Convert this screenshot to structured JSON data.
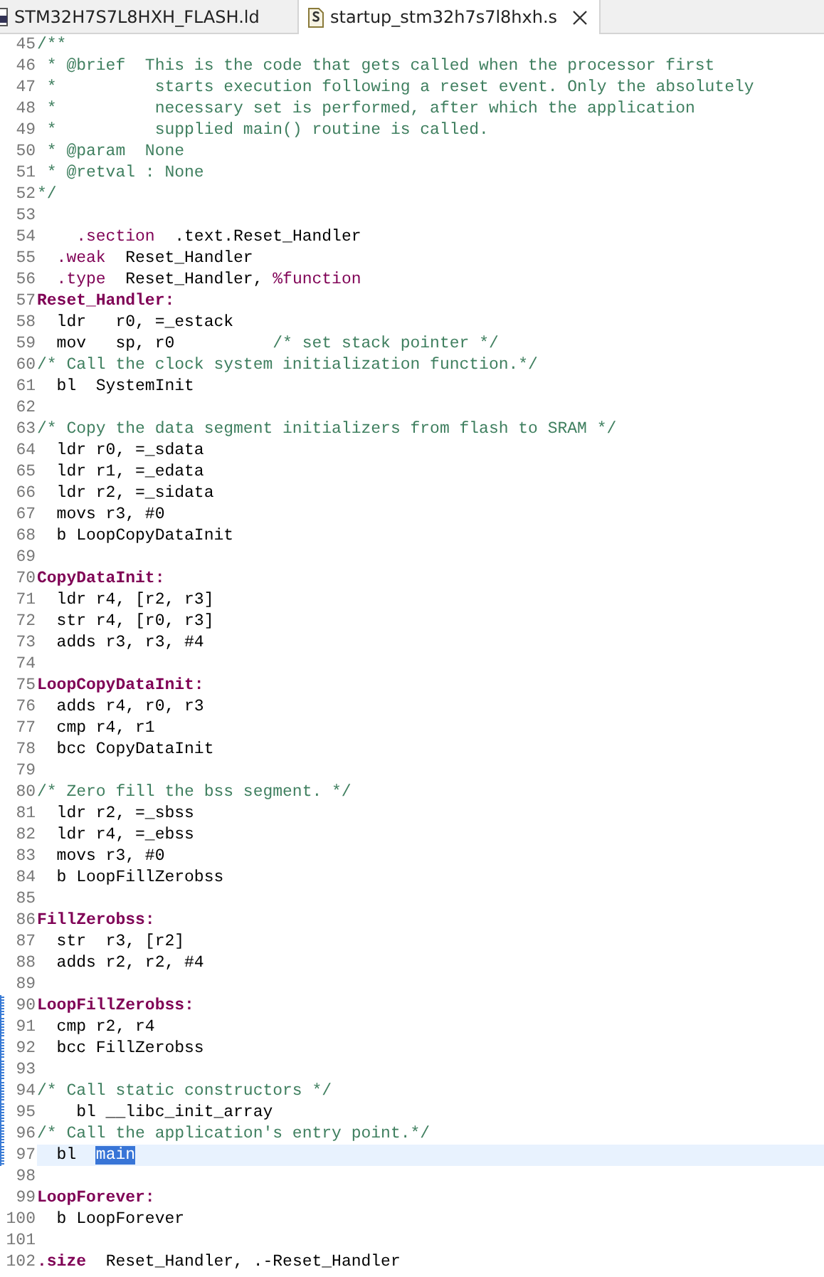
{
  "tabs": [
    {
      "label": "STM32H7S7L8HXH_FLASH.ld",
      "kind": "ld",
      "selected": false
    },
    {
      "label": "startup_stm32h7s7l8hxh.s",
      "kind": "asm",
      "selected": true
    }
  ],
  "lines": [
    {
      "number": "45",
      "segments": [
        {
          "kind": "comment",
          "text": "/**"
        }
      ]
    },
    {
      "number": "46",
      "segments": [
        {
          "kind": "comment",
          "text": " * @brief  This is the code that gets called when the processor first"
        }
      ]
    },
    {
      "number": "47",
      "segments": [
        {
          "kind": "comment",
          "text": " *          starts execution following a reset event. Only the absolutely"
        }
      ]
    },
    {
      "number": "48",
      "segments": [
        {
          "kind": "comment",
          "text": " *          necessary set is performed, after which the application"
        }
      ]
    },
    {
      "number": "49",
      "segments": [
        {
          "kind": "comment",
          "text": " *          supplied main() routine is called."
        }
      ]
    },
    {
      "number": "50",
      "segments": [
        {
          "kind": "comment",
          "text": " * @param  None"
        }
      ]
    },
    {
      "number": "51",
      "segments": [
        {
          "kind": "comment",
          "text": " * @retval : None"
        }
      ]
    },
    {
      "number": "52",
      "segments": [
        {
          "kind": "comment",
          "text": "*/"
        }
      ]
    },
    {
      "number": "53"
    },
    {
      "number": "54",
      "segments": [
        {
          "kind": "directive",
          "text": "    .section"
        },
        {
          "kind": "plain",
          "text": "  .text.Reset_Handler"
        }
      ]
    },
    {
      "number": "55",
      "segments": [
        {
          "kind": "directive",
          "text": "  .weak"
        },
        {
          "kind": "plain",
          "text": "  Reset_Handler"
        }
      ]
    },
    {
      "number": "56",
      "segments": [
        {
          "kind": "directive",
          "text": "  .type"
        },
        {
          "kind": "plain",
          "text": "  Reset_Handler, "
        },
        {
          "kind": "directive",
          "text": "%function"
        }
      ]
    },
    {
      "number": "57",
      "segments": [
        {
          "kind": "label",
          "text": "Reset_Handler:"
        }
      ]
    },
    {
      "number": "58",
      "segments": [
        {
          "kind": "plain",
          "text": "  ldr   r0, =_estack"
        }
      ]
    },
    {
      "number": "59",
      "segments": [
        {
          "kind": "plain",
          "text": "  mov   sp, r0          "
        },
        {
          "kind": "comment",
          "text": "/* set stack pointer */"
        }
      ]
    },
    {
      "number": "60",
      "segments": [
        {
          "kind": "comment",
          "text": "/* Call the clock system initialization function.*/"
        }
      ]
    },
    {
      "number": "61",
      "segments": [
        {
          "kind": "plain",
          "text": "  bl  SystemInit"
        }
      ]
    },
    {
      "number": "62"
    },
    {
      "number": "63",
      "segments": [
        {
          "kind": "comment",
          "text": "/* Copy the data segment initializers from flash to SRAM */"
        }
      ]
    },
    {
      "number": "64",
      "segments": [
        {
          "kind": "plain",
          "text": "  ldr r0, =_sdata"
        }
      ]
    },
    {
      "number": "65",
      "segments": [
        {
          "kind": "plain",
          "text": "  ldr r1, =_edata"
        }
      ]
    },
    {
      "number": "66",
      "segments": [
        {
          "kind": "plain",
          "text": "  ldr r2, =_sidata"
        }
      ]
    },
    {
      "number": "67",
      "segments": [
        {
          "kind": "plain",
          "text": "  movs r3, #0"
        }
      ]
    },
    {
      "number": "68",
      "segments": [
        {
          "kind": "plain",
          "text": "  b LoopCopyDataInit"
        }
      ]
    },
    {
      "number": "69"
    },
    {
      "number": "70",
      "segments": [
        {
          "kind": "label",
          "text": "CopyDataInit:"
        }
      ]
    },
    {
      "number": "71",
      "segments": [
        {
          "kind": "plain",
          "text": "  ldr r4, [r2, r3]"
        }
      ]
    },
    {
      "number": "72",
      "segments": [
        {
          "kind": "plain",
          "text": "  str r4, [r0, r3]"
        }
      ]
    },
    {
      "number": "73",
      "segments": [
        {
          "kind": "plain",
          "text": "  adds r3, r3, #4"
        }
      ]
    },
    {
      "number": "74"
    },
    {
      "number": "75",
      "segments": [
        {
          "kind": "label",
          "text": "LoopCopyDataInit:"
        }
      ]
    },
    {
      "number": "76",
      "segments": [
        {
          "kind": "plain",
          "text": "  adds r4, r0, r3"
        }
      ]
    },
    {
      "number": "77",
      "segments": [
        {
          "kind": "plain",
          "text": "  cmp r4, r1"
        }
      ]
    },
    {
      "number": "78",
      "segments": [
        {
          "kind": "plain",
          "text": "  bcc CopyDataInit"
        }
      ]
    },
    {
      "number": "79"
    },
    {
      "number": "80",
      "segments": [
        {
          "kind": "comment",
          "text": "/* Zero fill the bss segment. */"
        }
      ]
    },
    {
      "number": "81",
      "segments": [
        {
          "kind": "plain",
          "text": "  ldr r2, =_sbss"
        }
      ]
    },
    {
      "number": "82",
      "segments": [
        {
          "kind": "plain",
          "text": "  ldr r4, =_ebss"
        }
      ]
    },
    {
      "number": "83",
      "segments": [
        {
          "kind": "plain",
          "text": "  movs r3, #0"
        }
      ]
    },
    {
      "number": "84",
      "segments": [
        {
          "kind": "plain",
          "text": "  b LoopFillZerobss"
        }
      ]
    },
    {
      "number": "85"
    },
    {
      "number": "86",
      "segments": [
        {
          "kind": "label",
          "text": "FillZerobss:"
        }
      ]
    },
    {
      "number": "87",
      "segments": [
        {
          "kind": "plain",
          "text": "  str  r3, [r2]"
        }
      ]
    },
    {
      "number": "88",
      "segments": [
        {
          "kind": "plain",
          "text": "  adds r2, r2, #4"
        }
      ]
    },
    {
      "number": "89"
    },
    {
      "number": "90",
      "marked": true,
      "segments": [
        {
          "kind": "label",
          "text": "LoopFillZerobss:"
        }
      ]
    },
    {
      "number": "91",
      "marked": true,
      "segments": [
        {
          "kind": "plain",
          "text": "  cmp r2, r4"
        }
      ]
    },
    {
      "number": "92",
      "marked": true,
      "segments": [
        {
          "kind": "plain",
          "text": "  bcc FillZerobss"
        }
      ]
    },
    {
      "number": "93",
      "marked": true
    },
    {
      "number": "94",
      "marked": true,
      "segments": [
        {
          "kind": "comment",
          "text": "/* Call static constructors */"
        }
      ]
    },
    {
      "number": "95",
      "marked": true,
      "segments": [
        {
          "kind": "plain",
          "text": "    bl __libc_init_array"
        }
      ]
    },
    {
      "number": "96",
      "marked": true,
      "segments": [
        {
          "kind": "comment",
          "text": "/* Call the application's entry point.*/"
        }
      ]
    },
    {
      "number": "97",
      "marked": true,
      "current": true,
      "segments": [
        {
          "kind": "plain",
          "text": "  bl  "
        },
        {
          "kind": "selected",
          "text": "main"
        }
      ]
    },
    {
      "number": "98"
    },
    {
      "number": "99",
      "segments": [
        {
          "kind": "label",
          "text": "LoopForever:"
        }
      ]
    },
    {
      "number": "100",
      "segments": [
        {
          "kind": "plain",
          "text": "  b LoopForever"
        }
      ]
    },
    {
      "number": "101"
    },
    {
      "number": "102",
      "segments": [
        {
          "kind": "directive-bold",
          "text": ".size"
        },
        {
          "kind": "plain",
          "text": "  Reset_Handler, .-Reset_Handler"
        }
      ]
    }
  ]
}
